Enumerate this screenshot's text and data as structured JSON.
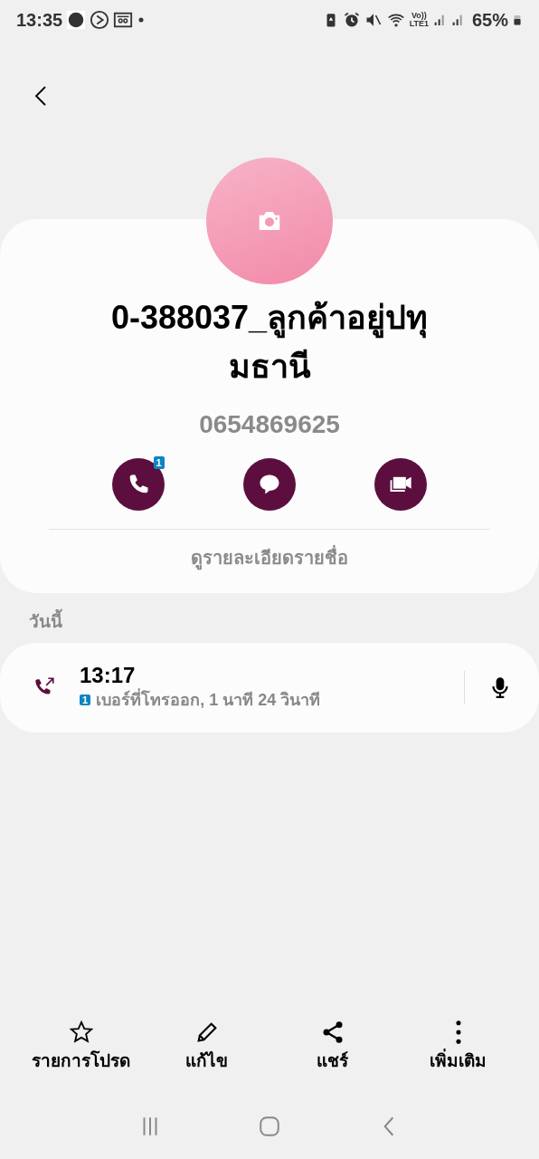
{
  "status_bar": {
    "time": "13:35",
    "network_label_top": "Vo))",
    "network_label_bottom": "LTE1",
    "battery": "65%"
  },
  "contact": {
    "name": "0-388037_ลูกค้าอยู่ปทุมธานี",
    "number": "0654869625",
    "actions": [
      {
        "kind": "call",
        "badge": "1"
      },
      {
        "kind": "message"
      },
      {
        "kind": "video"
      }
    ],
    "details_link": "ดูรายละเอียดรายชื่อ"
  },
  "section_title": "วันนี้",
  "call_log": [
    {
      "kind": "outgoing",
      "time": "13:17",
      "sim": "1",
      "description": "เบอร์ที่โทรออก, 1 นาที 24 วินาที"
    }
  ],
  "bottom_bar": [
    {
      "kind": "favorite",
      "label": "รายการโปรด"
    },
    {
      "kind": "edit",
      "label": "แก้ไข"
    },
    {
      "kind": "share",
      "label": "แชร์"
    },
    {
      "kind": "more",
      "label": "เพิ่มเติม"
    }
  ]
}
